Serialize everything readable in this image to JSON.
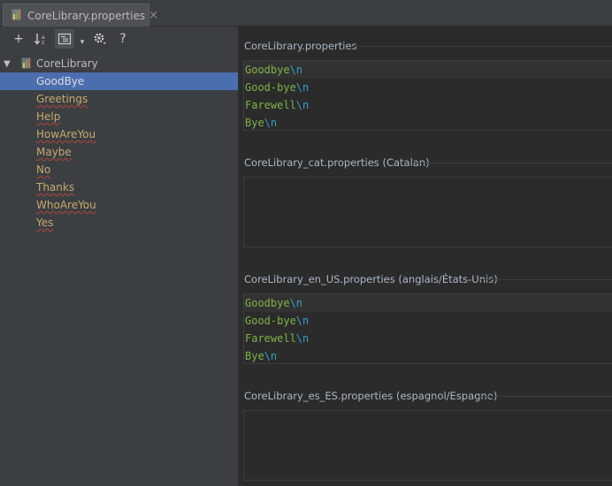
{
  "tab": {
    "title": "CoreLibrary.properties",
    "close": "×"
  },
  "toolbar": {
    "add": "+",
    "sort": "↓ᶻ",
    "group": "≣",
    "dropdown": "▾",
    "settings": "⚙",
    "help": "?"
  },
  "tree": {
    "root": "CoreLibrary",
    "items": [
      "GoodBye",
      "Greetings",
      "Help",
      "HowAreYou",
      "Maybe",
      "No",
      "Thanks",
      "WhoAreYou",
      "Yes"
    ],
    "selected_index": 0
  },
  "sections": [
    {
      "title": "CoreLibrary.properties",
      "lines": [
        {
          "text": "Goodbye",
          "escape": "\\n"
        },
        {
          "text": "Good-bye",
          "escape": "\\n"
        },
        {
          "text": "Farewell",
          "escape": "\\n"
        },
        {
          "text": "Bye",
          "escape": "\\n"
        }
      ]
    },
    {
      "title": "CoreLibrary_cat.properties (Catalan)",
      "lines": []
    },
    {
      "title": "CoreLibrary_en_US.properties (anglais/États-Unis)",
      "lines": [
        {
          "text": "Goodbye",
          "escape": "\\n"
        },
        {
          "text": "Good-bye",
          "escape": "\\n"
        },
        {
          "text": "Farewell",
          "escape": "\\n"
        },
        {
          "text": "Bye",
          "escape": "\\n"
        }
      ]
    },
    {
      "title": "CoreLibrary_es_ES.properties (espagnol/Espagne)",
      "lines": []
    }
  ],
  "colors": {
    "background": "#2b2b2b",
    "panel": "#3c3f41",
    "selection": "#4b6eaf",
    "value_text": "#7fb347",
    "escape_text": "#35a0c4",
    "key_text": "#c7a96f"
  }
}
